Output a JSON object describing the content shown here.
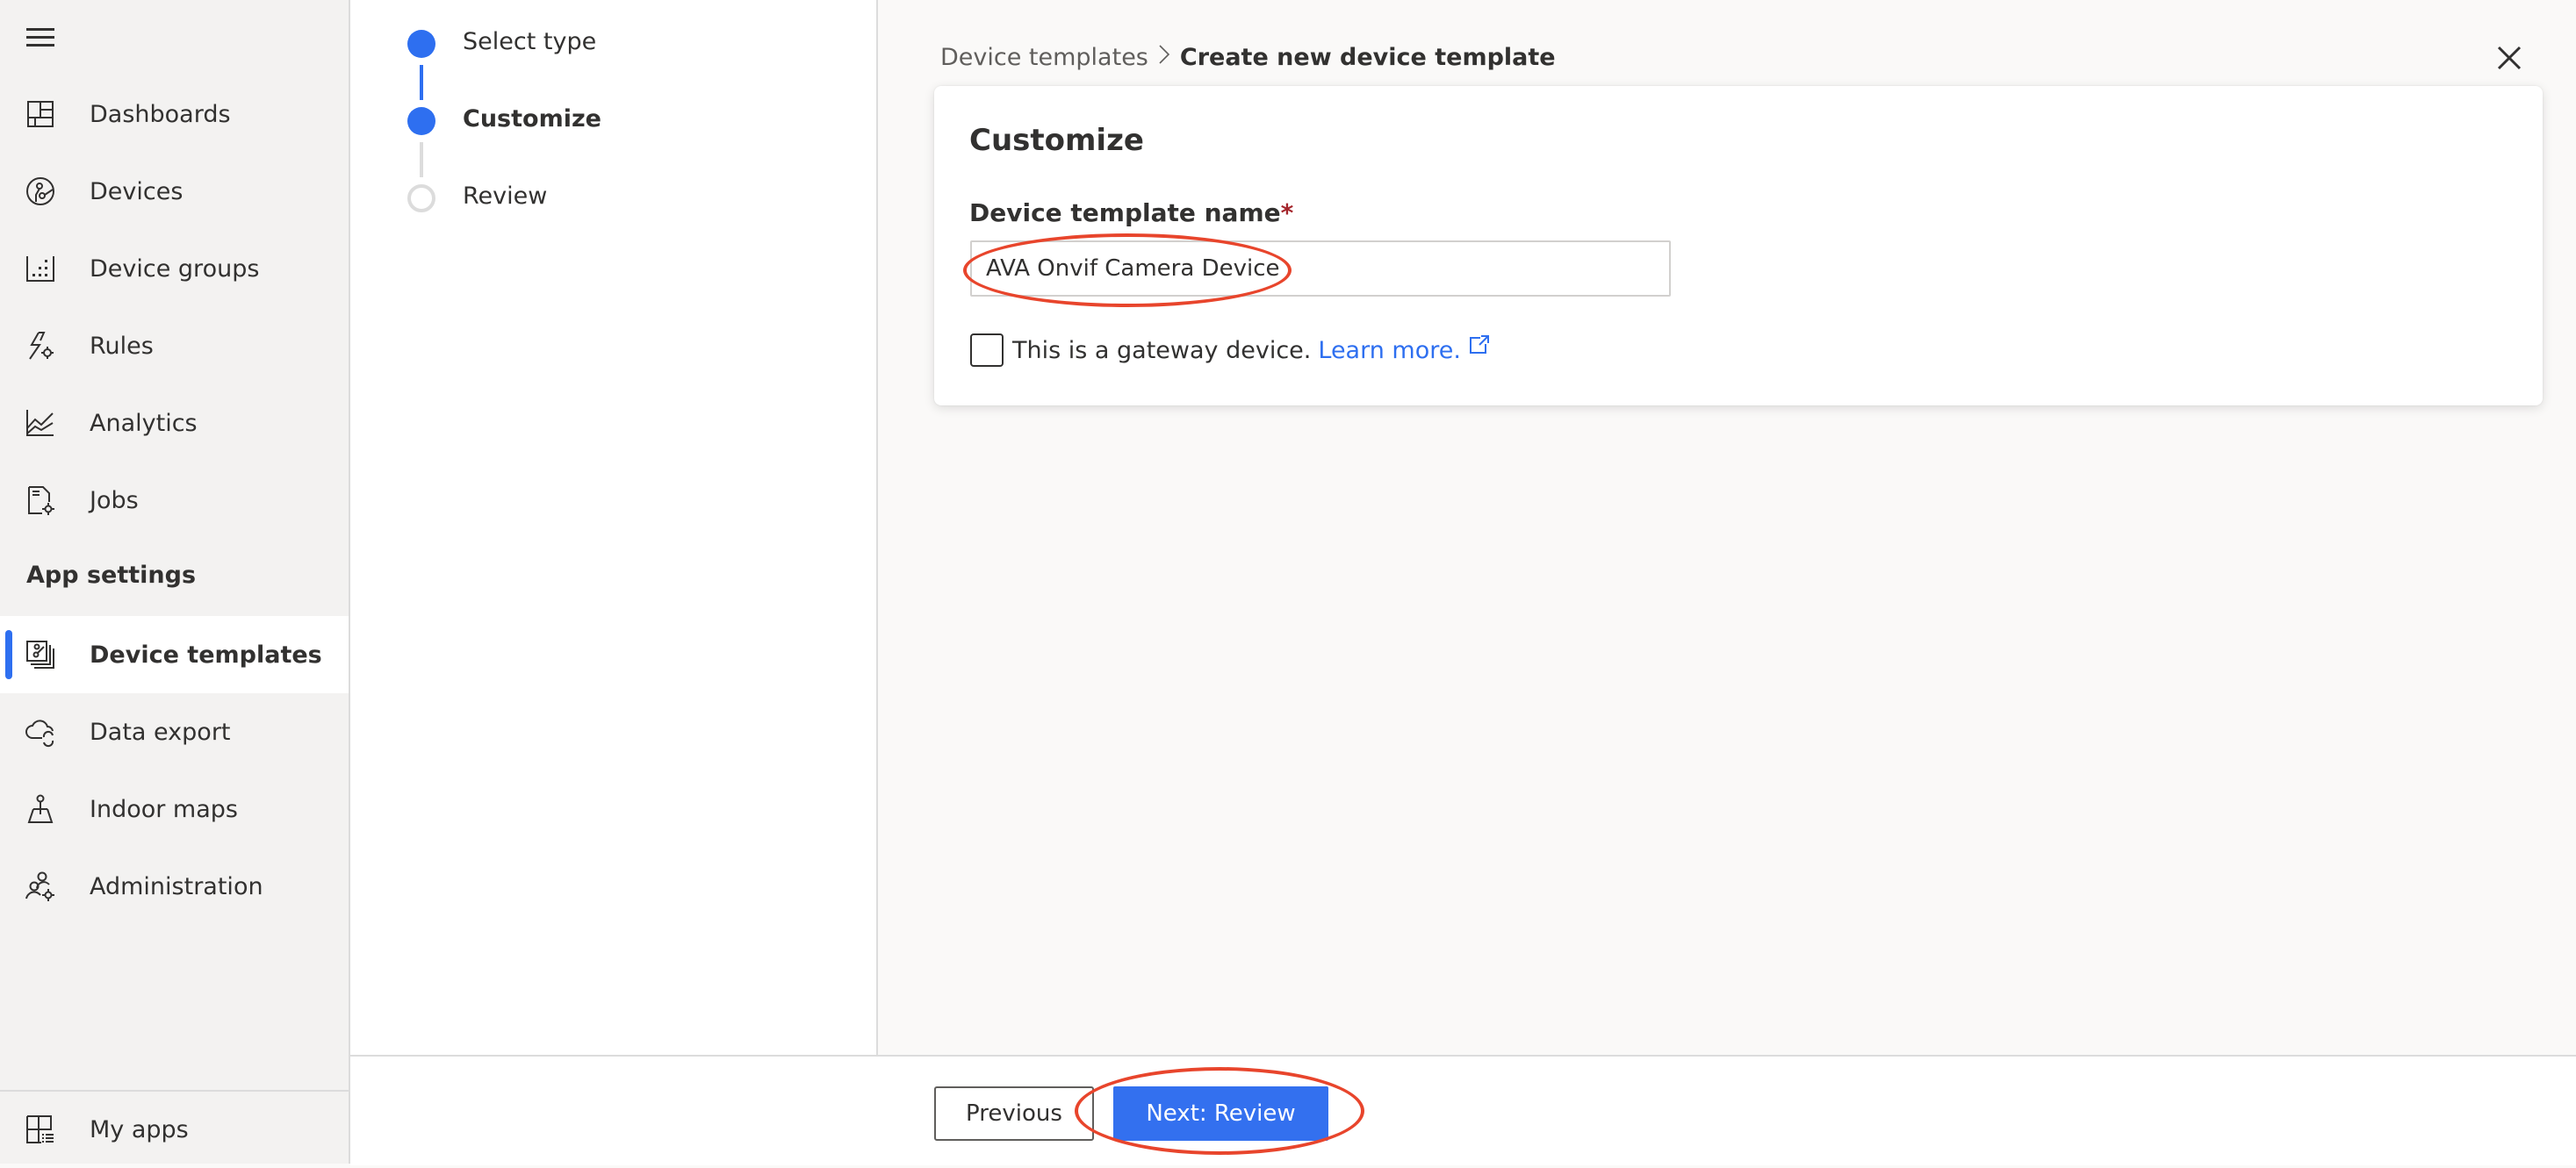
{
  "sidebar": {
    "menu_icon": "hamburger-icon",
    "items": [
      {
        "label": "Dashboards",
        "icon": "dashboard-icon"
      },
      {
        "label": "Devices",
        "icon": "devices-icon"
      },
      {
        "label": "Device groups",
        "icon": "device-groups-icon"
      },
      {
        "label": "Rules",
        "icon": "rules-icon"
      },
      {
        "label": "Analytics",
        "icon": "analytics-icon"
      },
      {
        "label": "Jobs",
        "icon": "jobs-icon"
      }
    ],
    "section_header": "App settings",
    "settings_items": [
      {
        "label": "Device templates",
        "icon": "device-templates-icon",
        "active": true
      },
      {
        "label": "Data export",
        "icon": "data-export-icon"
      },
      {
        "label": "Indoor maps",
        "icon": "indoor-maps-icon"
      },
      {
        "label": "Administration",
        "icon": "administration-icon"
      }
    ],
    "bottom_item": {
      "label": "My apps",
      "icon": "my-apps-icon"
    }
  },
  "wizard": {
    "steps": [
      {
        "label": "Select type",
        "status": "complete"
      },
      {
        "label": "Customize",
        "status": "current"
      },
      {
        "label": "Review",
        "status": "pending"
      }
    ]
  },
  "header": {
    "breadcrumb_parent": "Device templates",
    "breadcrumb_separator": ">",
    "breadcrumb_current": "Create new device template",
    "close_icon": "close-icon"
  },
  "card": {
    "title": "Customize",
    "name_label": "Device template name",
    "required_marker": "*",
    "name_value": "AVA Onvif Camera Device",
    "gateway_checked": false,
    "gateway_label": "This is a gateway device.",
    "learn_more": "Learn more."
  },
  "footer": {
    "previous_label": "Previous",
    "next_label": "Next: Review"
  },
  "colors": {
    "accent": "#2e6ff0",
    "primary_button": "#3370ef",
    "annotation": "#e8452c",
    "required": "#a4262c"
  }
}
